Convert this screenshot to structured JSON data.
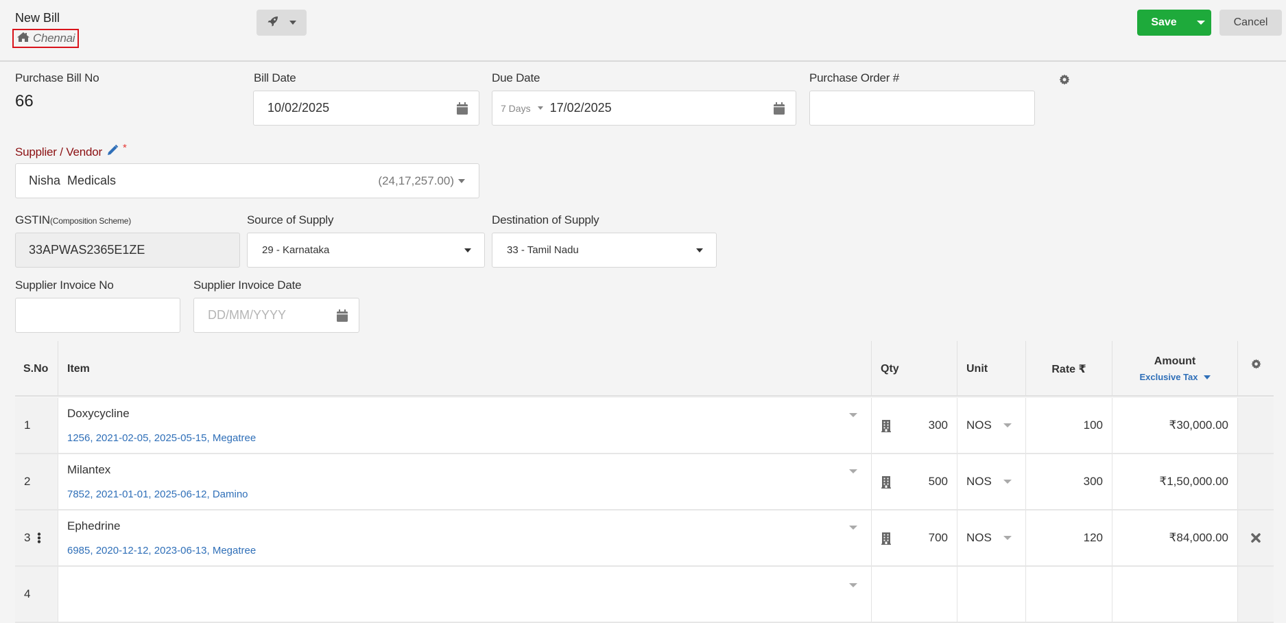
{
  "header": {
    "title": "New Bill",
    "branch": "Chennai",
    "quick_actions_icon": "rocket-icon",
    "save_label": "Save",
    "cancel_label": "Cancel"
  },
  "colors": {
    "primary": "#1eaa3b",
    "link": "#2f6fb8",
    "required_label": "#8b1012",
    "branch_outline": "#d9131b"
  },
  "form": {
    "bill_no": {
      "label": "Purchase Bill No",
      "value": "66"
    },
    "bill_date": {
      "label": "Bill Date",
      "value": "10/02/2025"
    },
    "due_date": {
      "label": "Due Date",
      "terms": "7 Days",
      "value": "17/02/2025"
    },
    "purchase_order": {
      "label": "Purchase Order #",
      "value": ""
    },
    "supplier": {
      "label": "Supplier / Vendor",
      "required_mark": "*",
      "value": "Nisha  Medicals",
      "balance": "(24,17,257.00)"
    },
    "gstin": {
      "label": "GSTIN",
      "sub_label": "(Composition Scheme)",
      "value": "33APWAS2365E1ZE"
    },
    "source_of_supply": {
      "label": "Source of Supply",
      "value": "29 - Karnataka"
    },
    "destination_of_supply": {
      "label": "Destination of Supply",
      "value": "33 - Tamil Nadu"
    },
    "supplier_invoice_no": {
      "label": "Supplier Invoice No",
      "value": ""
    },
    "supplier_invoice_date": {
      "label": "Supplier Invoice Date",
      "placeholder": "DD/MM/YYYY"
    }
  },
  "table": {
    "columns": {
      "sno": "S.No",
      "item": "Item",
      "qty": "Qty",
      "unit": "Unit",
      "rate": "Rate ₹",
      "amount": "Amount",
      "tax_mode": "Exclusive Tax"
    },
    "rows": [
      {
        "sno": "1",
        "item": "Doxycycline",
        "meta": "1256, 2021-02-05, 2025-05-15, Megatree",
        "qty": "300",
        "unit": "NOS",
        "rate": "100",
        "amount": "₹30,000.00"
      },
      {
        "sno": "2",
        "item": "Milantex",
        "meta": "7852, 2021-01-01, 2025-06-12, Damino",
        "qty": "500",
        "unit": "NOS",
        "rate": "300",
        "amount": "₹1,50,000.00"
      },
      {
        "sno": "3",
        "item": "Ephedrine",
        "meta": "6985, 2020-12-12, 2023-06-13, Megatree",
        "qty": "700",
        "unit": "NOS",
        "rate": "120",
        "amount": "₹84,000.00"
      },
      {
        "sno": "4",
        "item": "",
        "meta": "",
        "qty": "",
        "unit": "",
        "rate": "",
        "amount": ""
      }
    ]
  }
}
